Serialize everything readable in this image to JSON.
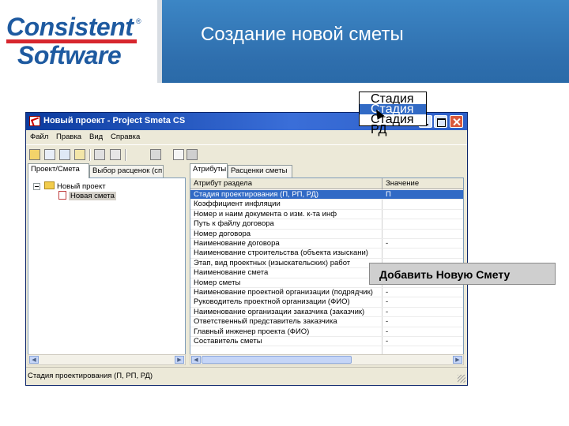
{
  "slide": {
    "logo_line1": "Consistent",
    "logo_line2": "Software",
    "logo_reg": "®",
    "title": "Создание новой сметы",
    "header_color": "#2f6fae"
  },
  "window": {
    "title": "Новый проект - Project Smeta CS",
    "menu": [
      "Файл",
      "Правка",
      "Вид",
      "Справка"
    ],
    "toolbar_icons": [
      "open-icon",
      "copy-icon",
      "find-icon",
      "save-icon",
      "cut-icon",
      "print-icon",
      "help-icon",
      "calculator-icon"
    ]
  },
  "left_panel": {
    "tabs": [
      "Проект/Смета",
      "Выбор расценок (сп"
    ],
    "tree": {
      "root": "Новый проект",
      "child": "Новая смета"
    }
  },
  "right_panel": {
    "tabs": [
      "Атрибуты",
      "Расценки сметы"
    ],
    "headers": {
      "attr": "Атрибут раздела",
      "value": "Значение"
    },
    "rows": [
      {
        "attr": "Стадия проектирования (П, РП, РД)",
        "value": "П"
      },
      {
        "attr": "Коэффициент инфляции",
        "value": ""
      },
      {
        "attr": "Номер и наим документа о изм. к-та инф",
        "value": ""
      },
      {
        "attr": "Путь к файлу договора",
        "value": ""
      },
      {
        "attr": "Номер договора",
        "value": ""
      },
      {
        "attr": "Наименование договора",
        "value": "-"
      },
      {
        "attr": "Наименование строительства (объекта изыскани)",
        "value": ""
      },
      {
        "attr": "Этап, вид проектных (изыскательских) работ",
        "value": ""
      },
      {
        "attr": "Наименование смета",
        "value": ""
      },
      {
        "attr": "Номер сметы",
        "value": ""
      },
      {
        "attr": "Наименование проектной организации (подрядчик)",
        "value": "-"
      },
      {
        "attr": "Руководитель проектной организации (ФИО)",
        "value": "-"
      },
      {
        "attr": "Наименование организации заказчика (заказчик)",
        "value": "-"
      },
      {
        "attr": "Ответственный представитель заказчика",
        "value": "-"
      },
      {
        "attr": "Главный инженер проекта (ФИО)",
        "value": "-"
      },
      {
        "attr": "Составитель сметы",
        "value": "-"
      }
    ],
    "dropdown_options": [
      "Стадия П",
      "Стадия РП",
      "Стадия РД"
    ],
    "dropdown_hover": "Стадия РП"
  },
  "status_bar": "Стадия проектирования (П, РП, РД)",
  "callout": "Добавить Новую Смету"
}
